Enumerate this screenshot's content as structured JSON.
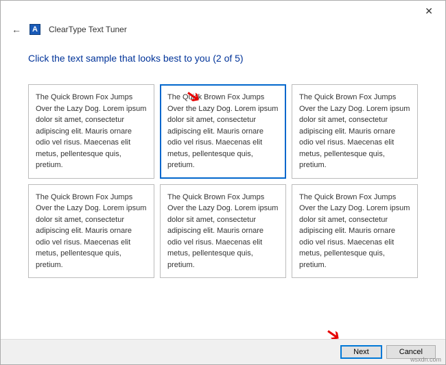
{
  "titlebar": {
    "close_glyph": "✕"
  },
  "header": {
    "back_glyph": "←",
    "app_icon_letter": "A",
    "app_title": "ClearType Text Tuner"
  },
  "content": {
    "heading": "Click the text sample that looks best to you (2 of 5)",
    "sample_text": "The Quick Brown Fox Jumps Over the Lazy Dog. Lorem ipsum dolor sit amet, consectetur adipiscing elit. Mauris ornare odio vel risus. Maecenas elit metus, pellentesque quis, pretium.",
    "selected_index": 1
  },
  "footer": {
    "next_label": "Next",
    "cancel_label": "Cancel"
  },
  "annotations": {
    "arrow_glyph": "➔"
  },
  "watermark": "wsxdn.com"
}
